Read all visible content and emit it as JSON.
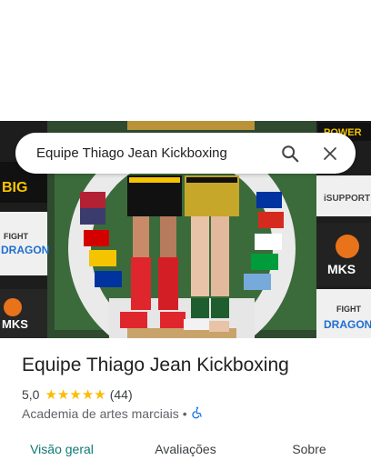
{
  "search": {
    "query": "Equipe Thiago Jean Kickboxing"
  },
  "place": {
    "name": "Equipe Thiago Jean Kickboxing",
    "rating_value": "5,0",
    "review_count": "(44)",
    "stars": 5,
    "category": "Academia de artes marciais",
    "separator": "•"
  },
  "photo_banners": {
    "support": "SUPPORT",
    "big_power": "BIG POWER",
    "fight_dragon_left": "FIGHT DRAGON",
    "mks_left": "MKS",
    "isupport": "iSUPPORT",
    "mks_right": "MKS",
    "fight_dragon_right": "FIGHT DRAGON",
    "power": "POWER"
  },
  "tabs": [
    {
      "label": "Visão geral",
      "active": true
    },
    {
      "label": "Avaliações",
      "active": false
    },
    {
      "label": "Sobre",
      "active": false
    }
  ],
  "colors": {
    "accent": "#0b7b71",
    "star": "#fbbc04",
    "wheelchair_icon": "#1a73e8"
  }
}
